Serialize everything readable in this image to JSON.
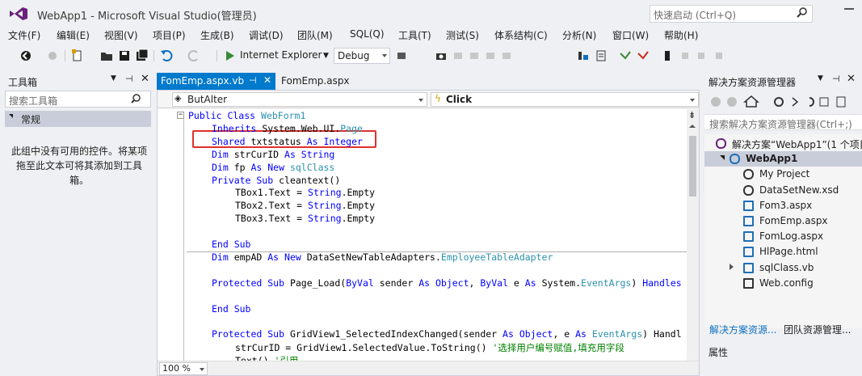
{
  "title": {
    "app_title": "WebApp1 - Microsoft Visual Studio(管理员)",
    "quick_launch_placeholder": "快速启动 (Ctrl+Q)"
  },
  "menu": [
    "文件(F)",
    "编辑(E)",
    "视图(V)",
    "项目(P)",
    "生成(B)",
    "调试(D)",
    "团队(M)",
    "SQL(Q)",
    "工具(T)",
    "测试(S)",
    "体系结构(C)",
    "分析(N)",
    "窗口(W)",
    "帮助(H)"
  ],
  "toolbar": {
    "browser": "Internet Explorer",
    "config": "Debug"
  },
  "toolbox": {
    "title": "工具箱",
    "search_placeholder": "搜索工具箱",
    "group": "常规",
    "empty_message": "此组中没有可用的控件。将某项拖至此文本可将其添加到工具箱。"
  },
  "editor": {
    "tabs": [
      {
        "label": "FomEmp.aspx.vb",
        "active": true
      },
      {
        "label": "FomEmp.aspx",
        "active": false
      }
    ],
    "nav_left": "ButAlter",
    "nav_right": "Click",
    "zoom": "100 %",
    "code": [
      {
        "indent": 0,
        "parts": [
          [
            "kw",
            "Public Class "
          ],
          [
            "ty",
            "WebForm1"
          ]
        ]
      },
      {
        "indent": 1,
        "parts": [
          [
            "kw",
            "Inherits "
          ],
          [
            "t",
            "System.Web.UI."
          ],
          [
            "ty",
            "Page"
          ]
        ]
      },
      {
        "indent": 1,
        "parts": [
          [
            "kw",
            "Shared "
          ],
          [
            "t",
            "txtstatus "
          ],
          [
            "kw",
            "As Integer"
          ]
        ]
      },
      {
        "indent": 1,
        "parts": [
          [
            "kw",
            "Dim "
          ],
          [
            "t",
            "strCurID "
          ],
          [
            "kw",
            "As String"
          ]
        ]
      },
      {
        "indent": 1,
        "parts": [
          [
            "kw",
            "Dim "
          ],
          [
            "t",
            "fp "
          ],
          [
            "kw",
            "As New "
          ],
          [
            "ty",
            "sqlClass"
          ]
        ]
      },
      {
        "indent": 1,
        "parts": [
          [
            "kw",
            "Private Sub "
          ],
          [
            "t",
            "cleantext()"
          ]
        ]
      },
      {
        "indent": 2,
        "parts": [
          [
            "t",
            "TBox1.Text = "
          ],
          [
            "kw",
            "String"
          ],
          [
            "t",
            ".Empty"
          ]
        ]
      },
      {
        "indent": 2,
        "parts": [
          [
            "t",
            "TBox2.Text = "
          ],
          [
            "kw",
            "String"
          ],
          [
            "t",
            ".Empty"
          ]
        ]
      },
      {
        "indent": 2,
        "parts": [
          [
            "t",
            "TBox3.Text = "
          ],
          [
            "kw",
            "String"
          ],
          [
            "t",
            ".Empty"
          ]
        ]
      },
      {
        "indent": 0,
        "parts": []
      },
      {
        "indent": 1,
        "parts": [
          [
            "kw",
            "End Sub"
          ]
        ]
      },
      {
        "indent": 1,
        "parts": [
          [
            "kw",
            "Dim "
          ],
          [
            "t",
            "empAD "
          ],
          [
            "kw",
            "As New "
          ],
          [
            "t",
            "DataSetNewTableAdapters."
          ],
          [
            "ty",
            "EmployeeTableAdapter"
          ]
        ]
      },
      {
        "indent": 0,
        "parts": []
      },
      {
        "indent": 1,
        "parts": [
          [
            "kw",
            "Protected Sub "
          ],
          [
            "t",
            "Page_Load("
          ],
          [
            "kw",
            "ByVal "
          ],
          [
            "t",
            "sender "
          ],
          [
            "kw",
            "As Object"
          ],
          [
            "t",
            ", "
          ],
          [
            "kw",
            "ByVal "
          ],
          [
            "t",
            "e "
          ],
          [
            "kw",
            "As "
          ],
          [
            "t",
            "System."
          ],
          [
            "ty",
            "EventArgs"
          ],
          [
            "t",
            ") "
          ],
          [
            "kw",
            "Handles"
          ]
        ]
      },
      {
        "indent": 0,
        "parts": []
      },
      {
        "indent": 1,
        "parts": [
          [
            "kw",
            "End Sub"
          ]
        ]
      },
      {
        "indent": 0,
        "parts": []
      },
      {
        "indent": 1,
        "parts": [
          [
            "kw",
            "Protected Sub "
          ],
          [
            "t",
            "GridView1_SelectedIndexChanged(sender "
          ],
          [
            "kw",
            "As Object"
          ],
          [
            "t",
            ", e "
          ],
          [
            "kw",
            "As "
          ],
          [
            "ty",
            "EventArgs"
          ],
          [
            "t",
            ") Handl"
          ]
        ]
      },
      {
        "indent": 2,
        "parts": [
          [
            "t",
            "strCurID = GridView1.SelectedValue.ToString() "
          ],
          [
            "cm",
            "'选择用户编号赋值,填充用字段"
          ]
        ]
      },
      {
        "indent": 2,
        "parts": [
          [
            "t",
            "Text() "
          ],
          [
            "cm",
            "'引用"
          ]
        ]
      }
    ]
  },
  "solution": {
    "title": "解决方案资源管理器",
    "search_placeholder": "搜索解决方案资源管理器(Ctrl+;)",
    "items": [
      {
        "label": "解决方案“WebApp1”(1 个项目)",
        "icon": "solution-icon"
      },
      {
        "label": "WebApp1",
        "icon": "web-project-icon"
      },
      {
        "label": "My Project",
        "icon": "wrench-icon"
      },
      {
        "label": "DataSetNew.xsd",
        "icon": "dataset-icon"
      },
      {
        "label": "Fom3.aspx",
        "icon": "aspx-file-icon"
      },
      {
        "label": "FomEmp.aspx",
        "icon": "aspx-file-icon"
      },
      {
        "label": "FomLog.aspx",
        "icon": "aspx-file-icon"
      },
      {
        "label": "HlPage.html",
        "icon": "html-file-icon"
      },
      {
        "label": "sqlClass.vb",
        "icon": "vb-file-icon"
      },
      {
        "label": "Web.config",
        "icon": "config-file-icon"
      }
    ],
    "bottom_tabs": [
      "解决方案资源...",
      "团队资源管理..."
    ],
    "properties_title": "属性"
  },
  "colors": {
    "accent": "#007acc",
    "highlight": "#e0302d",
    "keyword": "#0000ff",
    "type": "#2b91af",
    "comment": "#008000"
  }
}
